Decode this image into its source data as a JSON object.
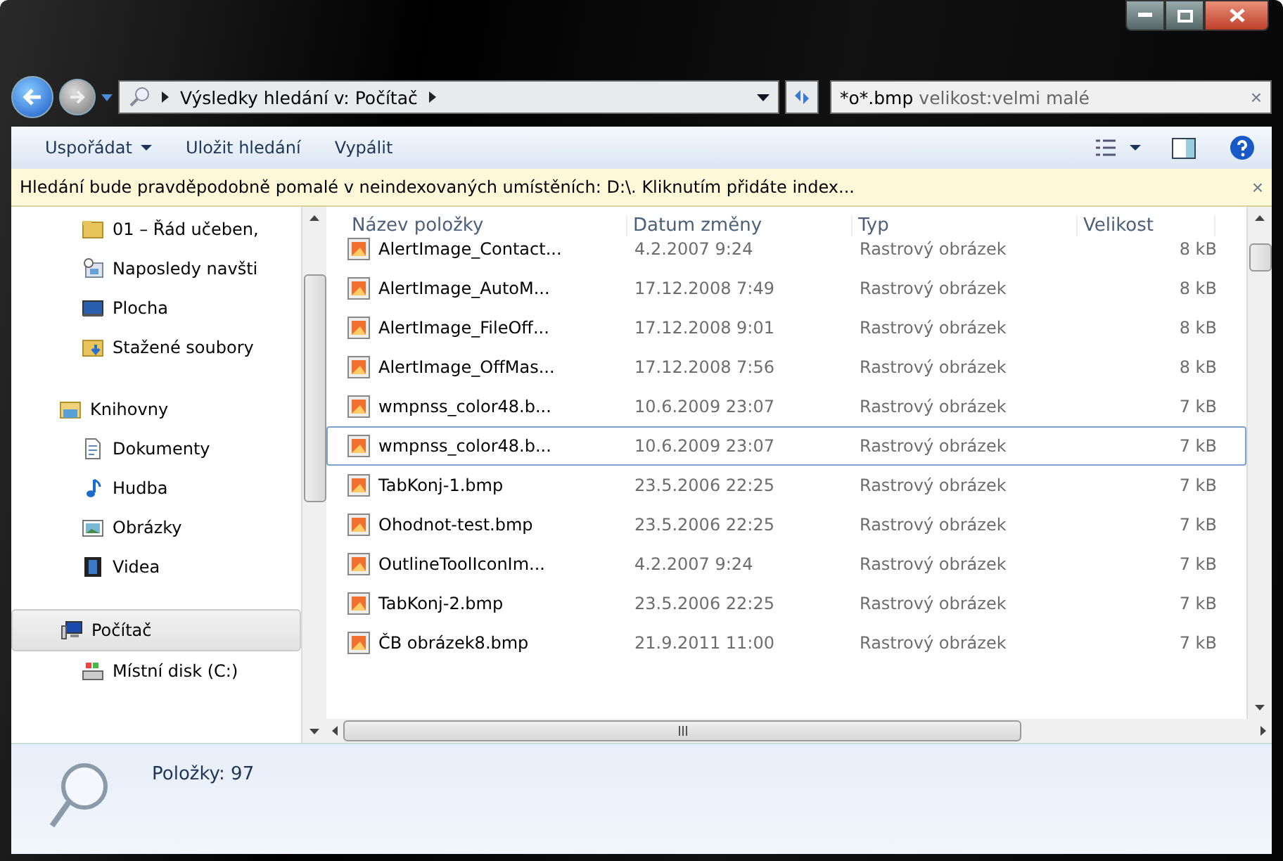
{
  "nav": {
    "address": [
      "Výsledky hledání v: Počítač"
    ],
    "search_query": "*o*.bmp",
    "search_filter": "velikost:velmi malé",
    "search_clear": "×"
  },
  "toolbar": {
    "buttons": [
      {
        "label": "Uspořádat",
        "dropdown": true
      },
      {
        "label": "Uložit hledání",
        "dropdown": false
      },
      {
        "label": "Vypálit",
        "dropdown": false
      }
    ]
  },
  "info_bar": {
    "message": "Hledání bude pravděpodobně pomalé v neindexovaných umístěních: D:\\. Kliknutím přidáte index...",
    "close": "×"
  },
  "sidebar": {
    "items": [
      {
        "label": "01 – Řád učeben,",
        "kind": "folder",
        "selected": false
      },
      {
        "label": "Naposledy navšti",
        "kind": "recent",
        "selected": false
      },
      {
        "label": "Plocha",
        "kind": "desktop",
        "selected": false
      },
      {
        "label": "Stažené soubory",
        "kind": "downloads",
        "selected": false
      },
      {
        "label": "Knihovny",
        "kind": "library",
        "selected": false,
        "children": [
          {
            "label": "Dokumenty",
            "kind": "document",
            "selected": false
          },
          {
            "label": "Hudba",
            "kind": "music",
            "selected": false
          },
          {
            "label": "Obrázky",
            "kind": "pictures",
            "selected": false
          },
          {
            "label": "Videa",
            "kind": "video",
            "selected": false
          }
        ]
      },
      {
        "label": "Počítač",
        "kind": "computer",
        "selected": true,
        "children": [
          {
            "label": "Místní disk (C:)",
            "kind": "disk",
            "selected": false
          }
        ]
      }
    ]
  },
  "table": {
    "columns": [
      "Název položky",
      "Datum změny",
      "Typ",
      "Velikost"
    ],
    "rows": [
      {
        "name": "AlertImage_Contact...",
        "date": "4.2.2007 9:24",
        "type": "Rastrový obrázek",
        "size": "8 kB",
        "selected": false
      },
      {
        "name": "AlertImage_AutoM...",
        "date": "17.12.2008 7:49",
        "type": "Rastrový obrázek",
        "size": "8 kB",
        "selected": false
      },
      {
        "name": "AlertImage_FileOff...",
        "date": "17.12.2008 9:01",
        "type": "Rastrový obrázek",
        "size": "8 kB",
        "selected": false
      },
      {
        "name": "AlertImage_OffMas...",
        "date": "17.12.2008 7:56",
        "type": "Rastrový obrázek",
        "size": "8 kB",
        "selected": false
      },
      {
        "name": "wmpnss_color48.b...",
        "date": "10.6.2009 23:07",
        "type": "Rastrový obrázek",
        "size": "7 kB",
        "selected": false
      },
      {
        "name": "wmpnss_color48.b...",
        "date": "10.6.2009 23:07",
        "type": "Rastrový obrázek",
        "size": "7 kB",
        "selected": true
      },
      {
        "name": "TabKonj-1.bmp",
        "date": "23.5.2006 22:25",
        "type": "Rastrový obrázek",
        "size": "7 kB",
        "selected": false
      },
      {
        "name": "Ohodnot-test.bmp",
        "date": "23.5.2006 22:25",
        "type": "Rastrový obrázek",
        "size": "7 kB",
        "selected": false
      },
      {
        "name": "OutlineToolIconIm...",
        "date": "4.2.2007 9:24",
        "type": "Rastrový obrázek",
        "size": "7 kB",
        "selected": false
      },
      {
        "name": "TabKonj-2.bmp",
        "date": "23.5.2006 22:25",
        "type": "Rastrový obrázek",
        "size": "7 kB",
        "selected": false
      },
      {
        "name": "ČB obrázek8.bmp",
        "date": "21.9.2011 11:00",
        "type": "Rastrový obrázek",
        "size": "7 kB",
        "selected": false
      }
    ]
  },
  "status_bar": {
    "text": "Položky: 97"
  }
}
